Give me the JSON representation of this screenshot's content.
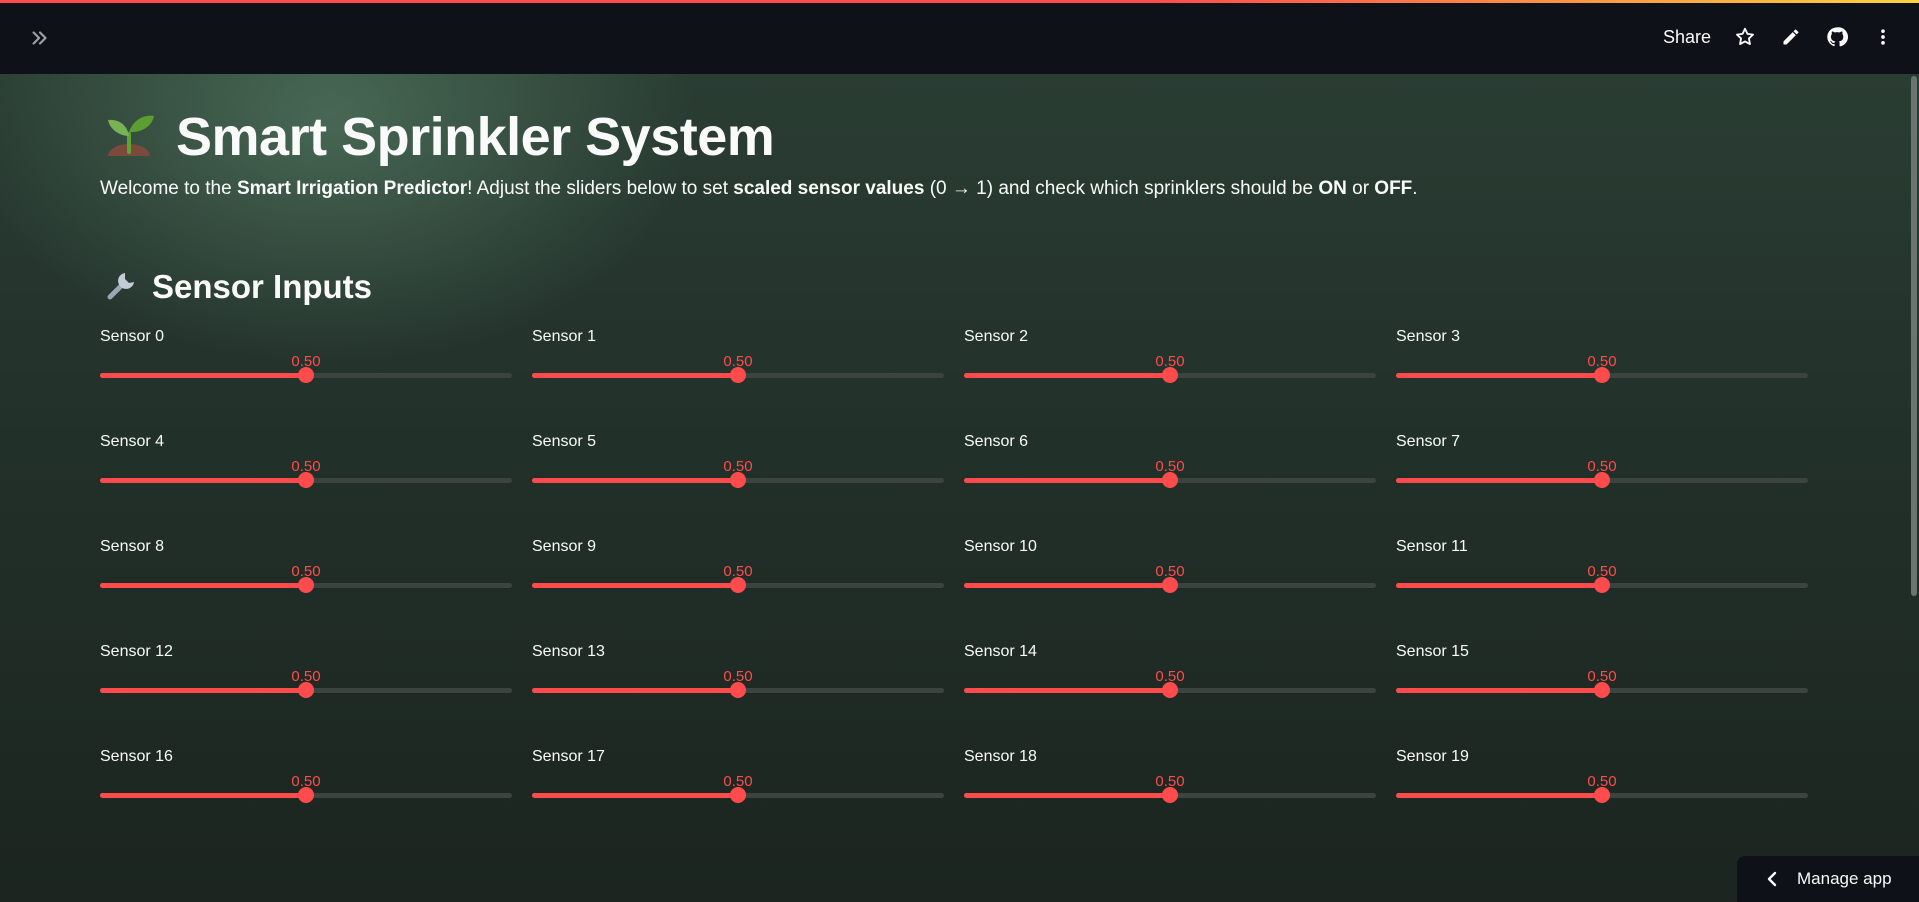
{
  "header": {
    "share_label": "Share",
    "icons": [
      "expand-sidebar-icon",
      "star-icon",
      "pencil-icon",
      "github-icon",
      "more-vertical-icon"
    ],
    "accent_colors": [
      "#ff4b4b",
      "#ffd23f"
    ]
  },
  "main": {
    "title_emoji": "🌱",
    "title": "Smart Sprinkler System",
    "intro": {
      "p1": "Welcome to the ",
      "b1": "Smart Irrigation Predictor",
      "p2": "! Adjust the sliders below to set ",
      "b2": "scaled sensor values",
      "p3": " (0 → 1) and check which sprinklers should be ",
      "b3": "ON",
      "p4": " or ",
      "b4": "OFF",
      "p5": "."
    },
    "section_emoji": "🔧",
    "section_title": "Sensor Inputs"
  },
  "sliders": [
    {
      "label": "Sensor 0",
      "display": "0.50",
      "value": 0.5
    },
    {
      "label": "Sensor 1",
      "display": "0.50",
      "value": 0.5
    },
    {
      "label": "Sensor 2",
      "display": "0.50",
      "value": 0.5
    },
    {
      "label": "Sensor 3",
      "display": "0.50",
      "value": 0.5
    },
    {
      "label": "Sensor 4",
      "display": "0.50",
      "value": 0.5
    },
    {
      "label": "Sensor 5",
      "display": "0.50",
      "value": 0.5
    },
    {
      "label": "Sensor 6",
      "display": "0.50",
      "value": 0.5
    },
    {
      "label": "Sensor 7",
      "display": "0.50",
      "value": 0.5
    },
    {
      "label": "Sensor 8",
      "display": "0.50",
      "value": 0.5
    },
    {
      "label": "Sensor 9",
      "display": "0.50",
      "value": 0.5
    },
    {
      "label": "Sensor 10",
      "display": "0.50",
      "value": 0.5
    },
    {
      "label": "Sensor 11",
      "display": "0.50",
      "value": 0.5
    },
    {
      "label": "Sensor 12",
      "display": "0.50",
      "value": 0.5
    },
    {
      "label": "Sensor 13",
      "display": "0.50",
      "value": 0.5
    },
    {
      "label": "Sensor 14",
      "display": "0.50",
      "value": 0.5
    },
    {
      "label": "Sensor 15",
      "display": "0.50",
      "value": 0.5
    },
    {
      "label": "Sensor 16",
      "display": "0.50",
      "value": 0.5
    },
    {
      "label": "Sensor 17",
      "display": "0.50",
      "value": 0.5
    },
    {
      "label": "Sensor 18",
      "display": "0.50",
      "value": 0.5
    },
    {
      "label": "Sensor 19",
      "display": "0.50",
      "value": 0.5
    }
  ],
  "slider_colors": {
    "active": "#ff4b4b",
    "track": "#3b4441"
  },
  "manage_app": {
    "label": "Manage app",
    "icon": "chevron-left-icon"
  }
}
